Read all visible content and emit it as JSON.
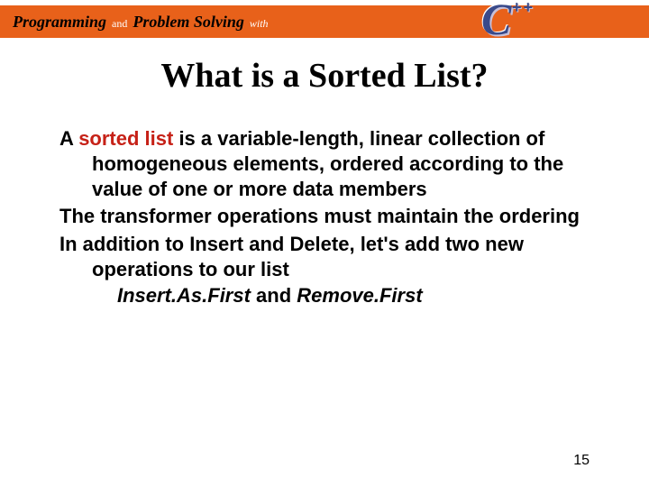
{
  "banner": {
    "programming": "Programming",
    "and": "and",
    "problem_solving": "Problem Solving",
    "with": "with",
    "logo_c": "C",
    "logo_pp": "++"
  },
  "title": "What is a Sorted List?",
  "p1_lead": "A ",
  "p1_red": "sorted list",
  "p1_rest": " is a variable-length, linear collection of homogeneous elements, ordered according to the value of one or more data members",
  "p2": "The transformer operations must maintain the ordering",
  "p3": "In addition to Insert and Delete, let's add two new operations to our list",
  "ops_1": "Insert.As.First",
  "ops_and": " and ",
  "ops_2": "Remove.First",
  "page_number": "15"
}
